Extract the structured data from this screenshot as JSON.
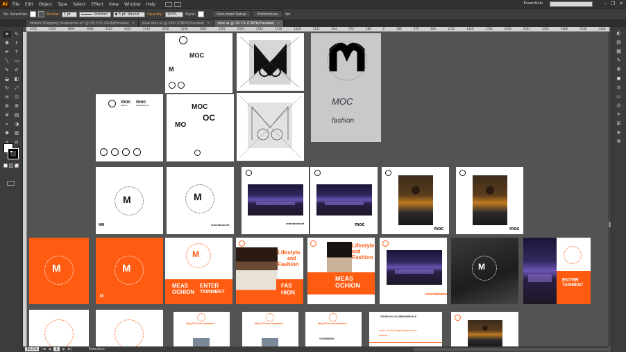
{
  "app": {
    "logo": "Ai"
  },
  "menu": [
    "File",
    "Edit",
    "Object",
    "Type",
    "Select",
    "Effect",
    "View",
    "Window",
    "Help"
  ],
  "workspace": "Essentials",
  "control": {
    "selection": "No Selection",
    "stroke_label": "Stroke:",
    "stroke_weight": "1 pt",
    "profile": "Uniform",
    "brush": "5 pt. Round",
    "opacity_label": "Opacity:",
    "opacity": "100%",
    "style_label": "Style:",
    "doc_setup": "Document Setup",
    "prefs": "Preferences"
  },
  "tabs": [
    {
      "label": "Mobile Shopping Illustration.ai* @ 33.33% (RGB/Preview)",
      "active": false
    },
    {
      "label": "blue moc.ai @ 25% (CMYK/Preview)",
      "active": false
    },
    {
      "label": "moc.ai @ 19.1% (CMYK/Preview)",
      "active": true
    }
  ],
  "ruler_ticks": [
    "5472",
    "5184",
    "4896",
    "4608",
    "4320",
    "4032",
    "3744",
    "3456",
    "3168",
    "2880",
    "2592",
    "2304",
    "2016",
    "1728",
    "1440",
    "1152",
    "864",
    "576",
    "288",
    "0",
    "288",
    "576",
    "864",
    "1152",
    "1440",
    "1728",
    "2016",
    "2304",
    "2592",
    "2880",
    "3168",
    "3456"
  ],
  "status": {
    "zoom": "19.1%",
    "page": "1",
    "tool": "Selection"
  },
  "artboards": {
    "moc": "MOC",
    "moc_fashion": "moc",
    "fashion": "fashion",
    "entertainment": "entertainment",
    "oc": "OC",
    "mo": "MO",
    "sketch_text_1": "MOC",
    "sketch_text_2": "fashion",
    "lifestyle": "Lifestyle",
    "and": "and",
    "fashion_cap": "Fashion",
    "meas": "MEAS",
    "ochion": "OCHION",
    "enter": "ENTER",
    "tainment": "TAINMENT",
    "fas": "FAS",
    "hion": "HION",
    "moc_ent": "moc",
    "moc_ent_sub": "entertainment",
    "card_name_1": "OGUNLAJA OLUWADAMILOLA",
    "card_line_1": "email: mocthedesigner@gmail.com",
    "card_line_2": "address: ...",
    "card_title": "Mwg Of Cross Industries",
    "card_small": "+2348080000"
  }
}
